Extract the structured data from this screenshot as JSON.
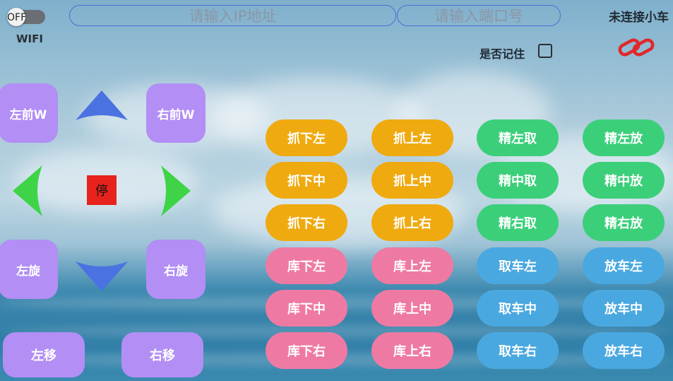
{
  "header": {
    "wifi_toggle": "OFF",
    "wifi_label": "WIFI",
    "ip_placeholder": "请输入IP地址",
    "port_placeholder": "请输入端口号",
    "connection_status": "未连接小车",
    "remember_label": "是否记住"
  },
  "colors": {
    "arrow_up_down": "#4a72e0",
    "arrow_left_right": "#3fd448",
    "pad_button": "#b28ef5",
    "stop_button": "#e8221d",
    "orange": "#efaa10",
    "green": "#3ccf7a",
    "pink": "#ee7aa3",
    "blue": "#4aa8e0",
    "link_icon": "#e0282a"
  },
  "pad": {
    "front_left": "左前W",
    "front_right": "右前W",
    "rotate_left": "左旋",
    "rotate_right": "右旋",
    "stop": "停",
    "move_left": "左移",
    "move_right": "右移",
    "icons": [
      "arrow-up-icon",
      "arrow-down-icon",
      "arrow-left-icon",
      "arrow-right-icon",
      "link-icon"
    ]
  },
  "grid": {
    "col1": [
      "抓下左",
      "抓下中",
      "抓下右",
      "库下左",
      "库下中",
      "库下右"
    ],
    "col2": [
      "抓上左",
      "抓上中",
      "抓上右",
      "库上左",
      "库上中",
      "库上右"
    ],
    "col3": [
      "精左取",
      "精中取",
      "精右取",
      "取车左",
      "取车中",
      "取车右"
    ],
    "col4": [
      "精左放",
      "精中放",
      "精右放",
      "放车左",
      "放车中",
      "放车右"
    ]
  }
}
